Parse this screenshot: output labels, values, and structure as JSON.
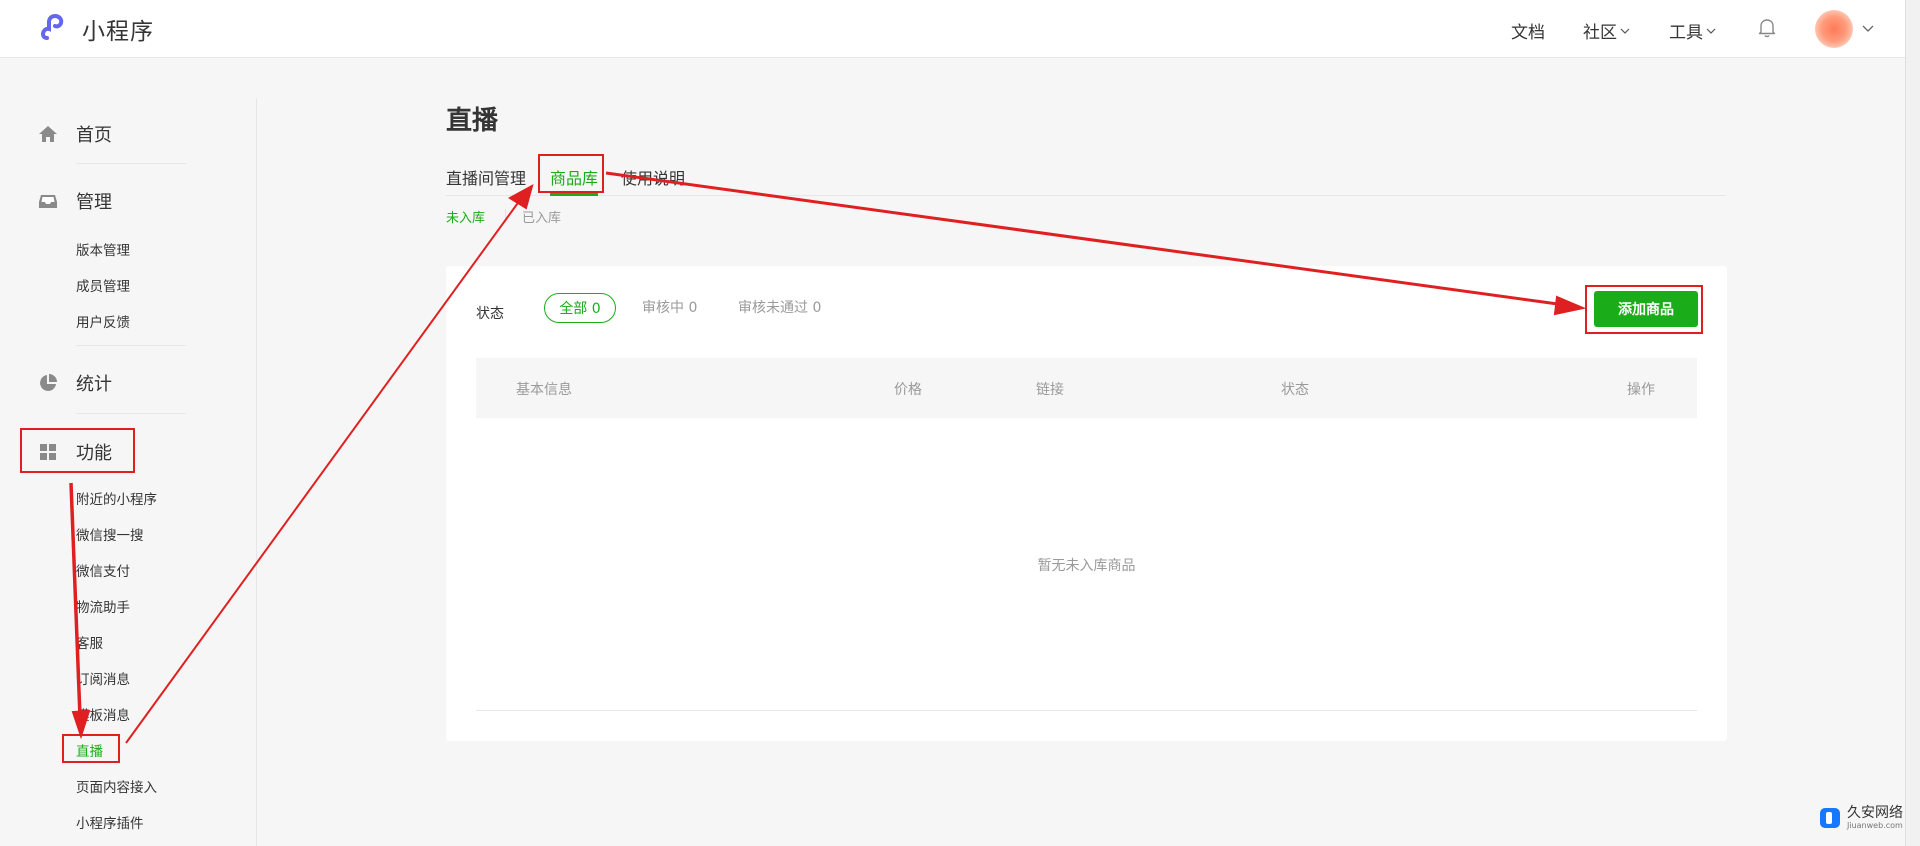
{
  "header": {
    "logo_text": "小程序",
    "nav": {
      "docs": "文档",
      "community": "社区",
      "tools": "工具"
    }
  },
  "sidebar": {
    "groups": [
      {
        "label": "首页",
        "icon": "home-icon"
      },
      {
        "label": "管理",
        "icon": "inbox-icon"
      },
      {
        "label": "统计",
        "icon": "pie-chart-icon"
      },
      {
        "label": "功能",
        "icon": "grid-icon"
      }
    ],
    "management_items": [
      "版本管理",
      "成员管理",
      "用户反馈"
    ],
    "feature_items": [
      "附近的小程序",
      "微信搜一搜",
      "微信支付",
      "物流助手",
      "客服",
      "订阅消息",
      "模板消息",
      "直播",
      "页面内容接入",
      "小程序插件"
    ],
    "active_item": "直播"
  },
  "main": {
    "title": "直播",
    "tabs": [
      "直播间管理",
      "商品库",
      "使用说明"
    ],
    "active_tab": "商品库",
    "subtabs": [
      "未入库",
      "已入库"
    ],
    "active_subtab": "未入库",
    "filter": {
      "label": "状态",
      "options": [
        "全部 0",
        "审核中 0",
        "审核未通过 0"
      ],
      "active": "全部 0"
    },
    "add_button": "添加商品",
    "table": {
      "columns": [
        "基本信息",
        "价格",
        "链接",
        "状态",
        "操作"
      ],
      "empty_text": "暂无未入库商品"
    }
  },
  "colors": {
    "accent": "#1aad19",
    "annotation": "#e02020",
    "logo": "#6467f0"
  },
  "watermark": {
    "main": "久安网络",
    "sub": "Jiuanweb.com"
  }
}
